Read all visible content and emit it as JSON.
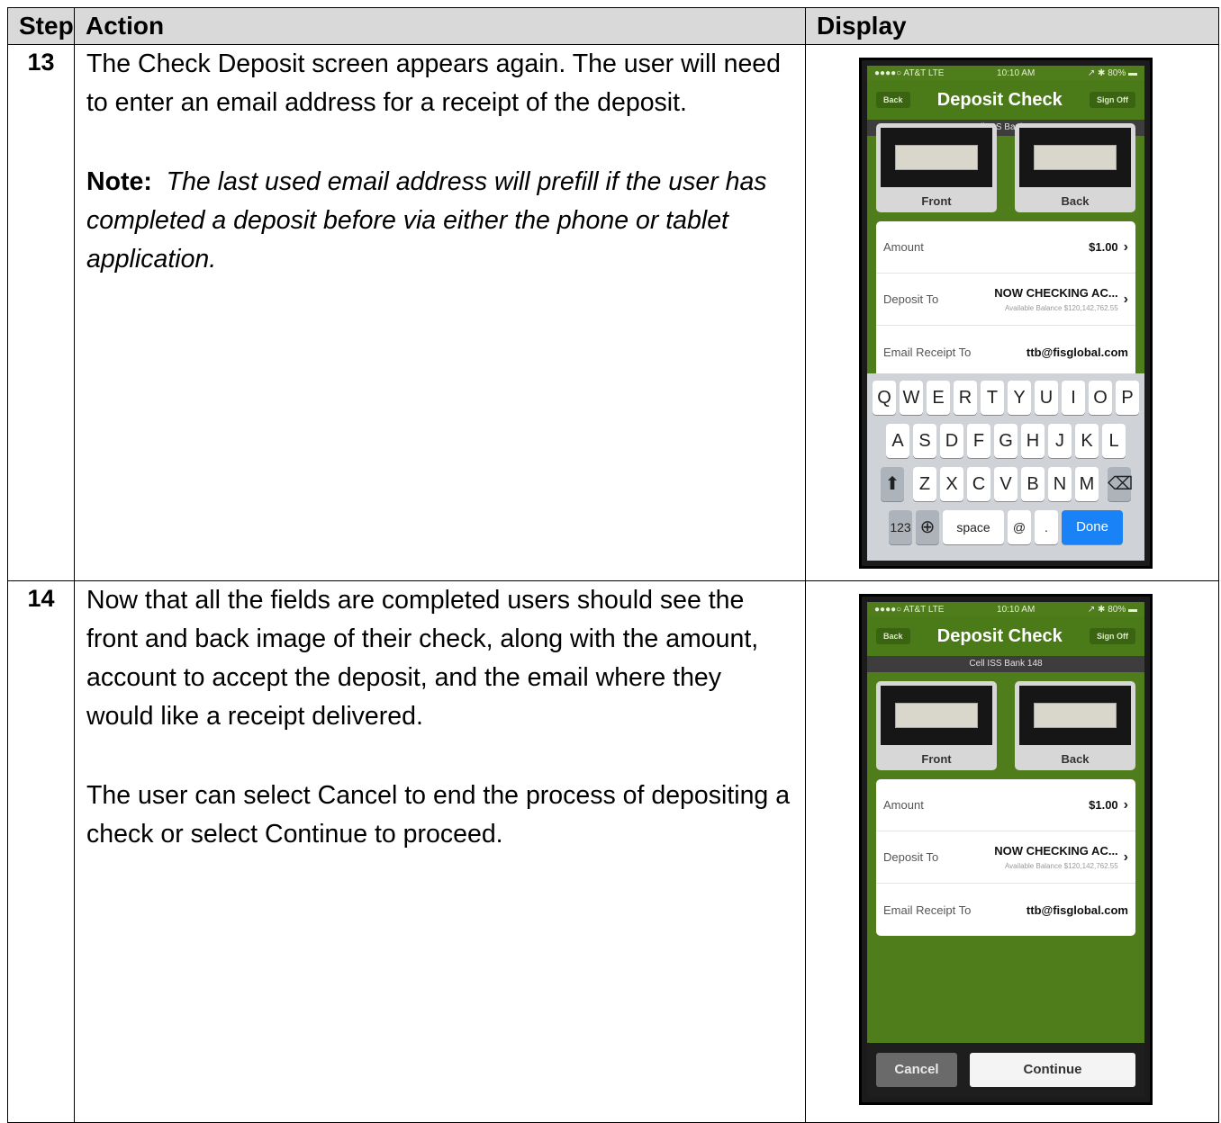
{
  "table": {
    "headers": {
      "step": "Step",
      "action": "Action",
      "display": "Display"
    }
  },
  "rows": [
    {
      "step": "13",
      "action_text": "The Check Deposit screen appears again.  The user will need to enter an email address for a receipt of the deposit.",
      "note_label": "Note:",
      "note_text": "The last used email address will prefill if the user has completed a deposit before via either the phone or tablet application."
    },
    {
      "step": "14",
      "action_text": "Now that all the fields are completed users should see the front and back image of their check, along with the amount, account to accept the deposit, and the email where they would like a receipt delivered.",
      "action_text_2": "The user can select Cancel to end the process of depositing a check or select Continue to proceed."
    }
  ],
  "phone": {
    "carrier": "●●●●○ AT&T  LTE",
    "time": "10:10 AM",
    "battery": "↗ ✱ 80% ▬",
    "back_label": "Back",
    "title": "Deposit Check",
    "sign_off_label": "Sign Off",
    "bank_bar": "Cell ISS Bank 148",
    "front_label": "Front",
    "back_card_label": "Back",
    "amount_label": "Amount",
    "amount_value": "$1.00",
    "deposit_to_label": "Deposit To",
    "deposit_to_value": "NOW CHECKING AC...",
    "available_balance": "Available Balance $120,142,762.55",
    "email_label": "Email Receipt To",
    "email_value": "ttb@fisglobal.com",
    "cancel_label": "Cancel",
    "continue_label": "Continue"
  },
  "keyboard": {
    "row1": [
      "Q",
      "W",
      "E",
      "R",
      "T",
      "Y",
      "U",
      "I",
      "O",
      "P"
    ],
    "row2": [
      "A",
      "S",
      "D",
      "F",
      "G",
      "H",
      "J",
      "K",
      "L"
    ],
    "row3": [
      "Z",
      "X",
      "C",
      "V",
      "B",
      "N",
      "M"
    ],
    "shift": "⬆",
    "delete": "⌫",
    "num": "123",
    "globe": "⊕",
    "space": "space",
    "at": "@",
    "period": ".",
    "done": "Done"
  }
}
